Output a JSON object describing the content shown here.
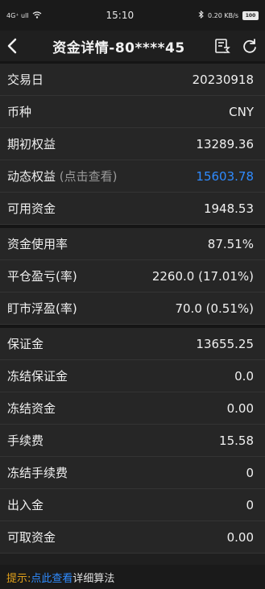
{
  "status_bar": {
    "network": "4G⁺ ull",
    "wifi": "wifi-signal",
    "time": "15:10",
    "speed": "0.20 KB/s",
    "battery": "100"
  },
  "header": {
    "title": "资金详情-80****45",
    "back_icon": "chevron-left-icon",
    "menu_icon": "list-sum-icon",
    "refresh_icon": "refresh-icon"
  },
  "section1": [
    {
      "label": "交易日",
      "hint": "",
      "value": "20230918",
      "value_color": "#f0f0f0"
    },
    {
      "label": "币种",
      "hint": "",
      "value": "CNY",
      "value_color": "#f0f0f0"
    },
    {
      "label": "期初权益",
      "hint": "",
      "value": "13289.36",
      "value_color": "#f0f0f0"
    },
    {
      "label": "动态权益",
      "hint": " (点击查看)",
      "value": "15603.78",
      "value_color": "#2f8bff"
    },
    {
      "label": "可用资金",
      "hint": "",
      "value": "1948.53",
      "value_color": "#f0f0f0"
    }
  ],
  "section2": [
    {
      "label": "资金使用率",
      "value": "87.51%"
    },
    {
      "label": "平仓盈亏(率)",
      "value": "2260.0 (17.01%)"
    },
    {
      "label": "盯市浮盈(率)",
      "value": "70.0 (0.51%)"
    }
  ],
  "section3": [
    {
      "label": "保证金",
      "value": "13655.25"
    },
    {
      "label": "冻结保证金",
      "value": "0.0"
    },
    {
      "label": "冻结资金",
      "value": "0.00"
    },
    {
      "label": "手续费",
      "value": "15.58"
    },
    {
      "label": "冻结手续费",
      "value": "0"
    },
    {
      "label": "出入金",
      "value": "0"
    },
    {
      "label": "可取资金",
      "value": "0.00"
    }
  ],
  "footer": {
    "tip_label": "提示:",
    "tip_link": "点此查看",
    "tip_rest": "详细算法"
  },
  "colors": {
    "accent_blue": "#2f8bff",
    "tip_orange": "#e3a21a",
    "background": "#1f1f1f"
  }
}
